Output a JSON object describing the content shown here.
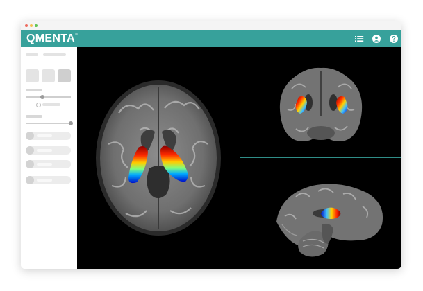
{
  "app": {
    "brand": "QMENTA",
    "trademark": "®"
  },
  "window_chrome": {
    "dots": [
      "#ed6a5e",
      "#f5bf4f",
      "#61c454"
    ]
  },
  "topbar": {
    "background": "#37a19b",
    "icons": [
      "list-icon",
      "user-icon",
      "help-icon"
    ]
  },
  "sidebar": {
    "layout_buttons": 3,
    "sliders": [
      {
        "value": 0.35
      },
      {
        "value": 0.97
      }
    ],
    "list_items": 4
  },
  "viewer": {
    "background": "#000000",
    "divider_color": "#2f8d87",
    "views": [
      "axial-view",
      "coronal-view",
      "sagittal-view"
    ],
    "overlay_colormap": "jet"
  }
}
